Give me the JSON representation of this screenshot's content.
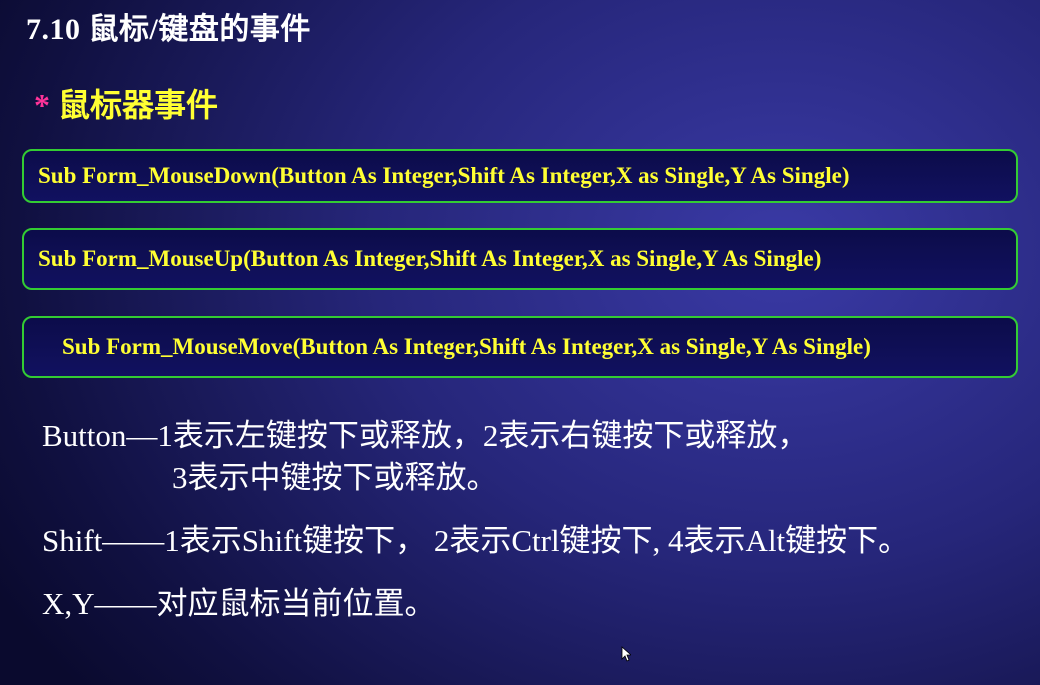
{
  "slide": {
    "title": "7.10  鼠标/键盘的事件",
    "subtitle_bullet": "*",
    "subtitle": "鼠标器事件",
    "code_lines": [
      "Sub Form_MouseDown(Button As Integer,Shift As Integer,X as Single,Y As Single)",
      "Sub Form_MouseUp(Button As Integer,Shift As Integer,X as Single,Y As Single)",
      "Sub Form_MouseMove(Button As Integer,Shift As Integer,X as Single,Y As Single)"
    ],
    "body": {
      "button_line1": "Button—1表示左键按下或释放，2表示右键按下或释放，",
      "button_line2": "3表示中键按下或释放。",
      "shift_line": "Shift——1表示Shift键按下， 2表示Ctrl键按下, 4表示Alt键按下。",
      "xy_line": "X,Y——对应鼠标当前位置。"
    }
  },
  "colors": {
    "title": "#ffffff",
    "subtitle": "#ffff33",
    "bullet": "#ff3399",
    "code_text": "#ffff33",
    "code_border": "#33cc33",
    "body_text": "#ffffff"
  },
  "icons": {
    "cursor": "mouse-pointer-icon"
  }
}
